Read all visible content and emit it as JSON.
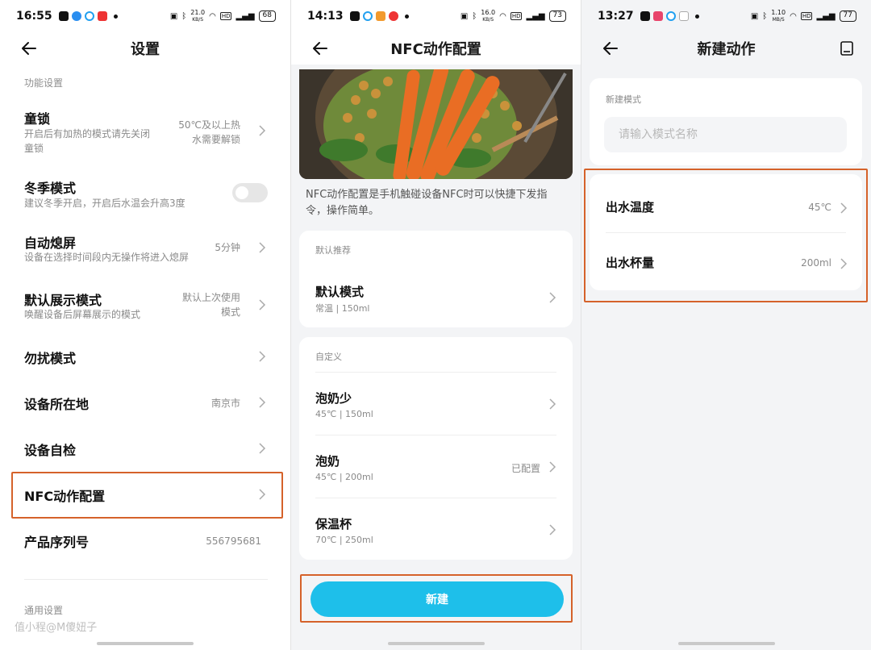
{
  "screen1": {
    "status": {
      "time": "16:55",
      "speed": "21.0",
      "speed_unit": "KB/S",
      "battery": "68"
    },
    "title": "设置",
    "section_function": "功能设置",
    "rows": [
      {
        "title": "童锁",
        "subtitle_l1": "开启后有加热的模式请先关闭",
        "subtitle_l2": "童锁",
        "value_l1": "50℃及以上热",
        "value_l2": "水需要解锁"
      },
      {
        "title": "冬季模式",
        "subtitle": "建议冬季开启，开启后水温会升高3度",
        "toggle_on": false
      },
      {
        "title": "自动熄屏",
        "subtitle": "设备在选择时间段内无操作将进入熄屏",
        "value": "5分钟"
      },
      {
        "title": "默认展示模式",
        "subtitle": "唤醒设备后屏幕展示的模式",
        "value_l1": "默认上次使用",
        "value_l2": "模式"
      },
      {
        "title": "勿扰模式"
      },
      {
        "title": "设备所在地",
        "value": "南京市"
      },
      {
        "title": "设备自检"
      },
      {
        "title": "NFC动作配置"
      },
      {
        "title": "产品序列号",
        "value": "556795681"
      }
    ],
    "section_general": "通用设置",
    "watermark": "值小程@M傻妞子"
  },
  "screen2": {
    "status": {
      "time": "14:13",
      "speed": "16.0",
      "speed_unit": "KB/S",
      "battery": "73"
    },
    "title": "NFC动作配置",
    "description": "NFC动作配置是手机触碰设备NFC时可以快捷下发指令，操作简单。",
    "default_label": "默认推荐",
    "default_item": {
      "title": "默认模式",
      "subtitle": "常温 | 150ml"
    },
    "custom_label": "自定义",
    "custom_items": [
      {
        "title": "泡奶少",
        "subtitle": "45℃ | 150ml",
        "value": ""
      },
      {
        "title": "泡奶",
        "subtitle": "45℃ | 200ml",
        "value": "已配置"
      },
      {
        "title": "保温杯",
        "subtitle": "70℃ | 250ml",
        "value": ""
      }
    ],
    "new_button": "新建"
  },
  "screen3": {
    "status": {
      "time": "13:27",
      "speed": "1.10",
      "speed_unit": "MB/S",
      "battery": "77"
    },
    "title": "新建动作",
    "mode_label": "新建模式",
    "mode_placeholder": "请输入模式名称",
    "items": [
      {
        "title": "出水温度",
        "value": "45℃"
      },
      {
        "title": "出水杯量",
        "value": "200ml"
      }
    ]
  },
  "colors": {
    "accent": "#1ebfea",
    "highlight": "#d5622a",
    "background": "#f3f4f6"
  }
}
